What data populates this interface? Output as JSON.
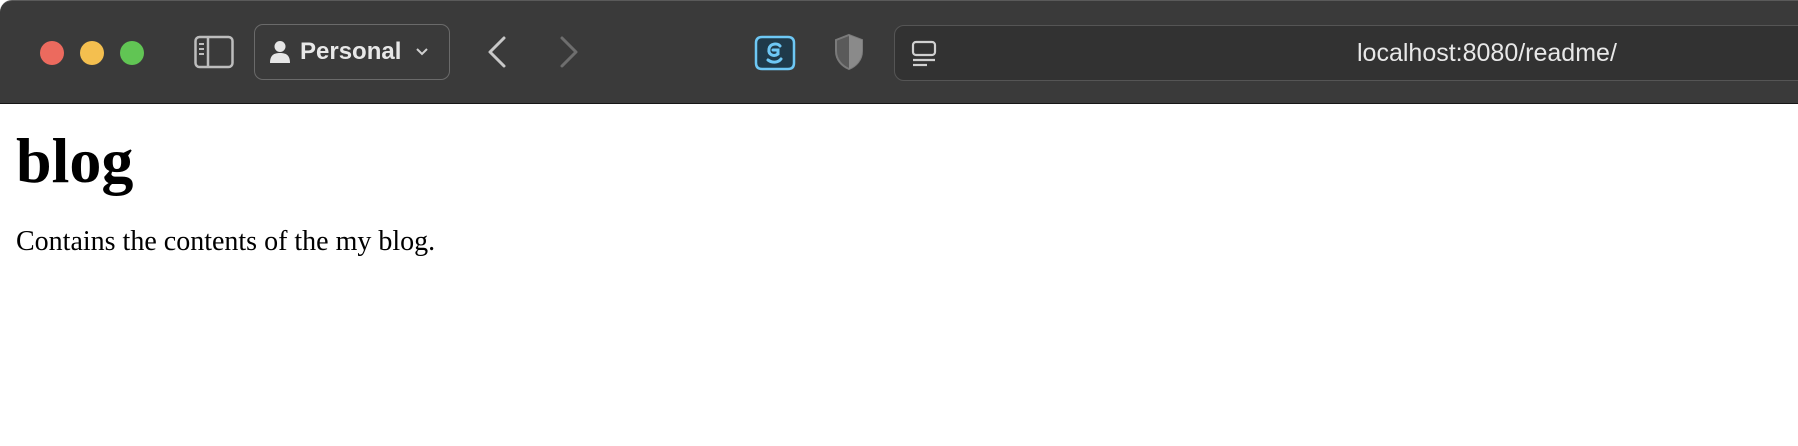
{
  "browser": {
    "profile_label": "Personal",
    "url": "localhost:8080/readme/",
    "icons": {
      "close": "close-button",
      "minimize": "minimize-button",
      "maximize": "maximize-button",
      "sidebar": "sidebar-icon",
      "profile": "person-icon",
      "back": "chevron-left-icon",
      "forward": "chevron-right-icon",
      "extension": "extension-icon",
      "privacy": "shield-icon",
      "reader": "reader-icon"
    },
    "colors": {
      "toolbar": "#3a3a3a",
      "close": "#ec6a5e",
      "minimize": "#f4bf4f",
      "maximize": "#61c554",
      "extension_accent": "#6ec8f5"
    }
  },
  "page": {
    "heading": "blog",
    "paragraph": "Contains the contents of the my blog."
  }
}
